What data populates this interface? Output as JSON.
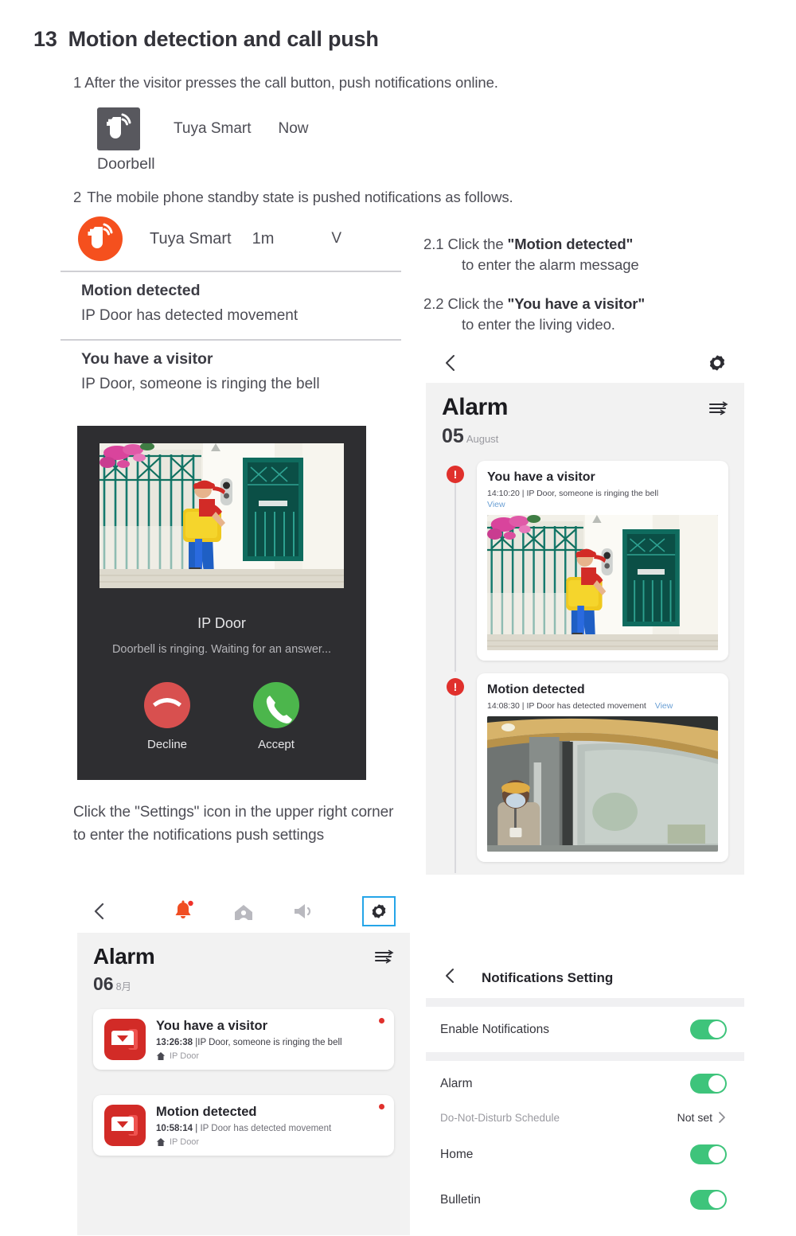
{
  "heading": {
    "number": "13",
    "title": "Motion detection and call push"
  },
  "steps": {
    "one": "1 After the visitor presses the call button, push notifications online.",
    "two_num": "2",
    "two": "The mobile phone standby state is pushed notifications  as follows."
  },
  "banner_notification": {
    "icon": "tuya-logo-icon",
    "app": "Tuya Smart",
    "time": "Now",
    "title": "Doorbell"
  },
  "lock_notifications": {
    "icon": "tuya-logo-icon",
    "app": "Tuya Smart",
    "time": "1m",
    "expand_chevron": "V",
    "items": [
      {
        "title": "Motion detected",
        "subtitle": "IP Door has detected movement"
      },
      {
        "title": "You have a visitor",
        "subtitle": "IP Door, someone is ringing the bell"
      }
    ]
  },
  "instructions": {
    "i21": {
      "num": "2.1",
      "before": "Click the ",
      "quote": "\"Motion detected\"",
      "line2": "to enter the alarm message"
    },
    "i22": {
      "num": "2.2",
      "before": "Click the ",
      "quote": "\"You have a visitor\"",
      "line2": "to enter the living video."
    }
  },
  "call_screen": {
    "device_name": "IP Door",
    "status": "Doorbell is ringing. Waiting for an answer...",
    "decline_label": "Decline",
    "accept_label": "Accept"
  },
  "settings_note": "Click the \"Settings\" icon in the upper right corner to enter the notifications push settings",
  "left_phone": {
    "toolbar": {
      "back": "back-chevron-icon",
      "bell": "bell-alert-icon",
      "home": "home-person-icon",
      "speaker": "speaker-icon",
      "gear": "gear-icon"
    },
    "alarm": {
      "title": "Alarm",
      "day": "06",
      "month": "8月",
      "filter_icon": "filter-list-icon",
      "cards": [
        {
          "title": "You have a visitor",
          "time": "13:26:38",
          "separator": "|",
          "detail": "IP Door, someone is ringing the bell",
          "device": "IP Door"
        },
        {
          "title": "Motion detected",
          "time": "10:58:14",
          "separator": "|",
          "detail": "IP Door has detected movement",
          "device": "IP Door"
        }
      ]
    }
  },
  "right_phone": {
    "topbar": {
      "back": "back-chevron-icon",
      "gear": "gear-icon"
    },
    "alarm": {
      "title": "Alarm",
      "day": "05",
      "month": "August",
      "filter_icon": "filter-list-icon",
      "cards": [
        {
          "title": "You have a visitor",
          "time": "14:10:20",
          "separator": "|",
          "detail": "IP Door, someone is ringing the bell",
          "view": "View",
          "thumbnail": "delivery-man-at-gate-photo"
        },
        {
          "title": "Motion detected",
          "time": "14:08:30",
          "separator": "|",
          "detail": "IP Door has detected movement",
          "view": "View",
          "thumbnail": "masked-person-in-corridor-photo"
        }
      ]
    }
  },
  "notifications_setting": {
    "back": "back-chevron-icon",
    "title": "Notifications Setting",
    "rows": [
      {
        "label": "Enable Notifications",
        "type": "toggle",
        "value": "on"
      },
      {
        "label": "Alarm",
        "type": "toggle",
        "value": "on"
      },
      {
        "label": "Do-Not-Disturb Schedule",
        "type": "link",
        "value": "Not set"
      },
      {
        "label": "Home",
        "type": "toggle",
        "value": "on"
      },
      {
        "label": "Bulletin",
        "type": "toggle",
        "value": "on"
      }
    ]
  },
  "colors": {
    "tuya_orange": "#f5501e",
    "accent_blue": "#25a5e8",
    "toggle_green": "#3ec47b",
    "alert_red": "#e0302c",
    "decline_red": "#d8504f",
    "accept_green": "#4cb64c"
  }
}
